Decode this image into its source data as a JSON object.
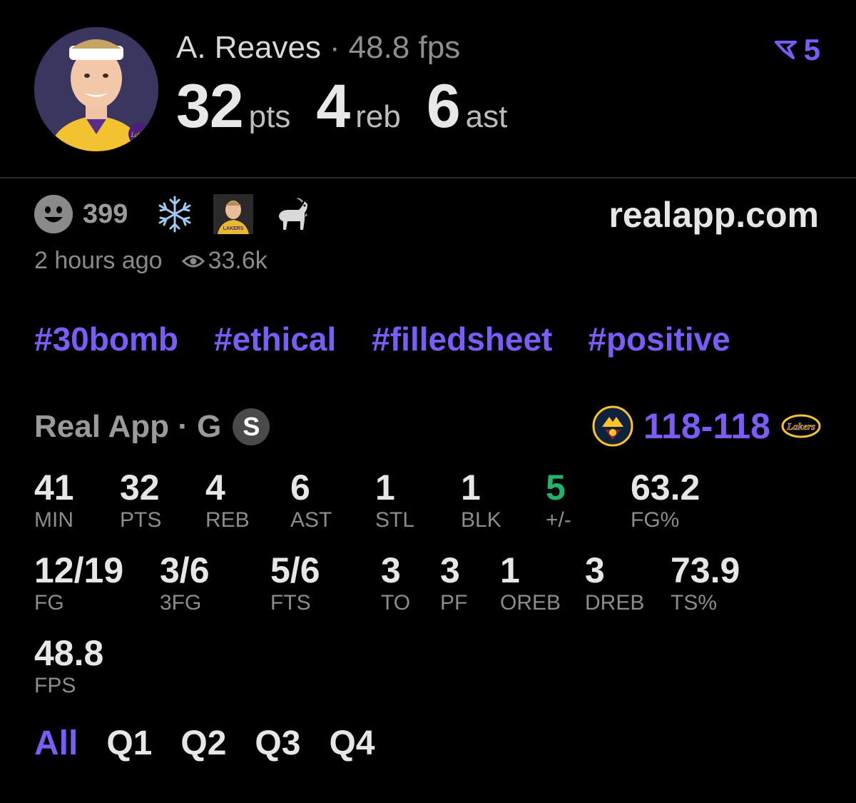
{
  "player": {
    "name": "A. Reaves",
    "separator": "·",
    "fps_label": "48.8 fps",
    "headline": [
      {
        "value": "32",
        "unit": "pts"
      },
      {
        "value": "4",
        "unit": "reb"
      },
      {
        "value": "6",
        "unit": "ast"
      }
    ]
  },
  "corner_badge": {
    "count": "5",
    "icon": "arrow-down-left-icon",
    "color": "#7a5cf5"
  },
  "reactions": {
    "count": "399",
    "emojis": [
      "snowflake-icon",
      "player-photo-icon",
      "goat-icon"
    ]
  },
  "site": "realapp.com",
  "meta": {
    "time": "2 hours ago",
    "views": "33.6k"
  },
  "tags": [
    "#30bomb",
    "#ethical",
    "#filledsheet",
    "#positive"
  ],
  "game": {
    "source": "Real App · G",
    "badge": "S",
    "score": "118-118",
    "home_team_icon": "nuggets-logo-icon",
    "away_team_icon": "lakers-logo-icon"
  },
  "stats": {
    "row1": [
      {
        "value": "41",
        "label": "MIN"
      },
      {
        "value": "32",
        "label": "PTS"
      },
      {
        "value": "4",
        "label": "REB"
      },
      {
        "value": "6",
        "label": "AST"
      },
      {
        "value": "1",
        "label": "STL"
      },
      {
        "value": "1",
        "label": "BLK"
      },
      {
        "value": "5",
        "label": "+/-"
      },
      {
        "value": "63.2",
        "label": "FG%"
      }
    ],
    "row2": [
      {
        "value": "12/19",
        "label": "FG"
      },
      {
        "value": "3/6",
        "label": "3FG"
      },
      {
        "value": "5/6",
        "label": "FTS"
      },
      {
        "value": "3",
        "label": "TO"
      },
      {
        "value": "3",
        "label": "PF"
      },
      {
        "value": "1",
        "label": "OREB"
      },
      {
        "value": "3",
        "label": "DREB"
      },
      {
        "value": "73.9",
        "label": "TS%"
      }
    ],
    "row3": [
      {
        "value": "48.8",
        "label": "FPS"
      }
    ]
  },
  "quarters": [
    "All",
    "Q1",
    "Q2",
    "Q3",
    "Q4"
  ],
  "colors": {
    "accent": "#7c5cf6",
    "positive": "#23b26b",
    "background": "#000000"
  }
}
